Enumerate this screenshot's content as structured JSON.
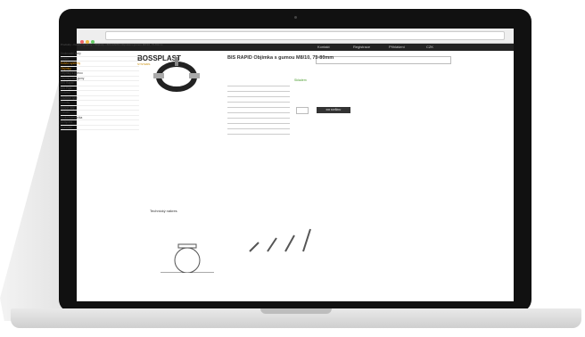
{
  "site": {
    "logo": "BOSSPLAST",
    "logo_sub": "SYSTEMS"
  },
  "topbar": {
    "items": [
      "Kontakt",
      "Registrace",
      "Přihlášení",
      "CZK"
    ]
  },
  "breadcrumb": "Produkty › Kotvicí systémy › Objímky › BIS RAPID Objímka s gumou M8/10, 75-80mm",
  "sidebar": {
    "items": [
      "Vodovodní sady",
      "Kotvicí",
      "Kotvicí systémy",
      "Objímky",
      "Objímky s gumou",
      "Objímky bez gumy",
      "BIS Rapid",
      "BIS Pipe",
      "Kotvení",
      "Závitové tyče",
      "Šrouby",
      "Nosné lišty",
      "Ostatní",
      "Vzduchotechnika",
      "Uchycení",
      "Speciální"
    ]
  },
  "product": {
    "title": "BIS RAPID Objímka s gumou M8/10, 75-80mm",
    "stock": "Skladem",
    "buy_label": "DO KOŠÍKU"
  },
  "drawing": {
    "title": "Technický nákres"
  }
}
